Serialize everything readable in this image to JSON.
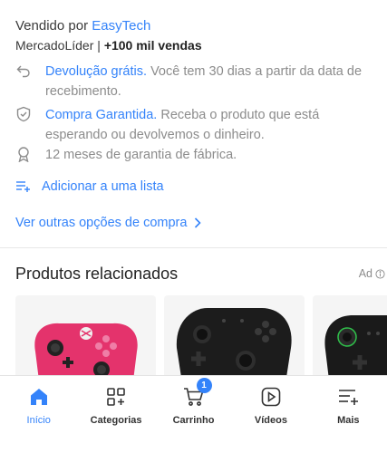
{
  "seller": {
    "prefix": "Vendido por",
    "name": "EasyTech",
    "tier": "MercadoLíder",
    "separator": "|",
    "sales": "+100 mil vendas"
  },
  "benefits": [
    {
      "icon": "return-arrow-icon",
      "link": "Devolução grátis.",
      "text": "Você tem 30 dias a partir da data de recebimento."
    },
    {
      "icon": "shield-check-icon",
      "link": "Compra Garantida.",
      "text": "Receba o produto que está esperando ou devolvemos o dinheiro."
    },
    {
      "icon": "award-ribbon-icon",
      "link": "",
      "text": "12 meses de garantia de fábrica."
    }
  ],
  "add_to_list": "Adicionar a uma lista",
  "other_options": "Ver outras opções de compra",
  "related": {
    "title": "Produtos relacionados",
    "ad_label": "Ad",
    "products": [
      {
        "name": "pink-xbox-controller",
        "color": "#e8336f"
      },
      {
        "name": "black-pro-controller",
        "color": "#1c1c1c"
      },
      {
        "name": "black-green-controller",
        "color": "#1a1a1a"
      }
    ]
  },
  "tabbar": {
    "tabs": [
      {
        "label": "Início",
        "icon": "home-icon",
        "active": true
      },
      {
        "label": "Categorias",
        "icon": "categories-icon",
        "active": false
      },
      {
        "label": "Carrinho",
        "icon": "cart-icon",
        "active": false,
        "badge": "1"
      },
      {
        "label": "Vídeos",
        "icon": "video-icon",
        "active": false
      },
      {
        "label": "Mais",
        "icon": "more-menu-icon",
        "active": false
      }
    ]
  },
  "colors": {
    "link": "#3483fa",
    "muted": "#8c8c8c"
  }
}
